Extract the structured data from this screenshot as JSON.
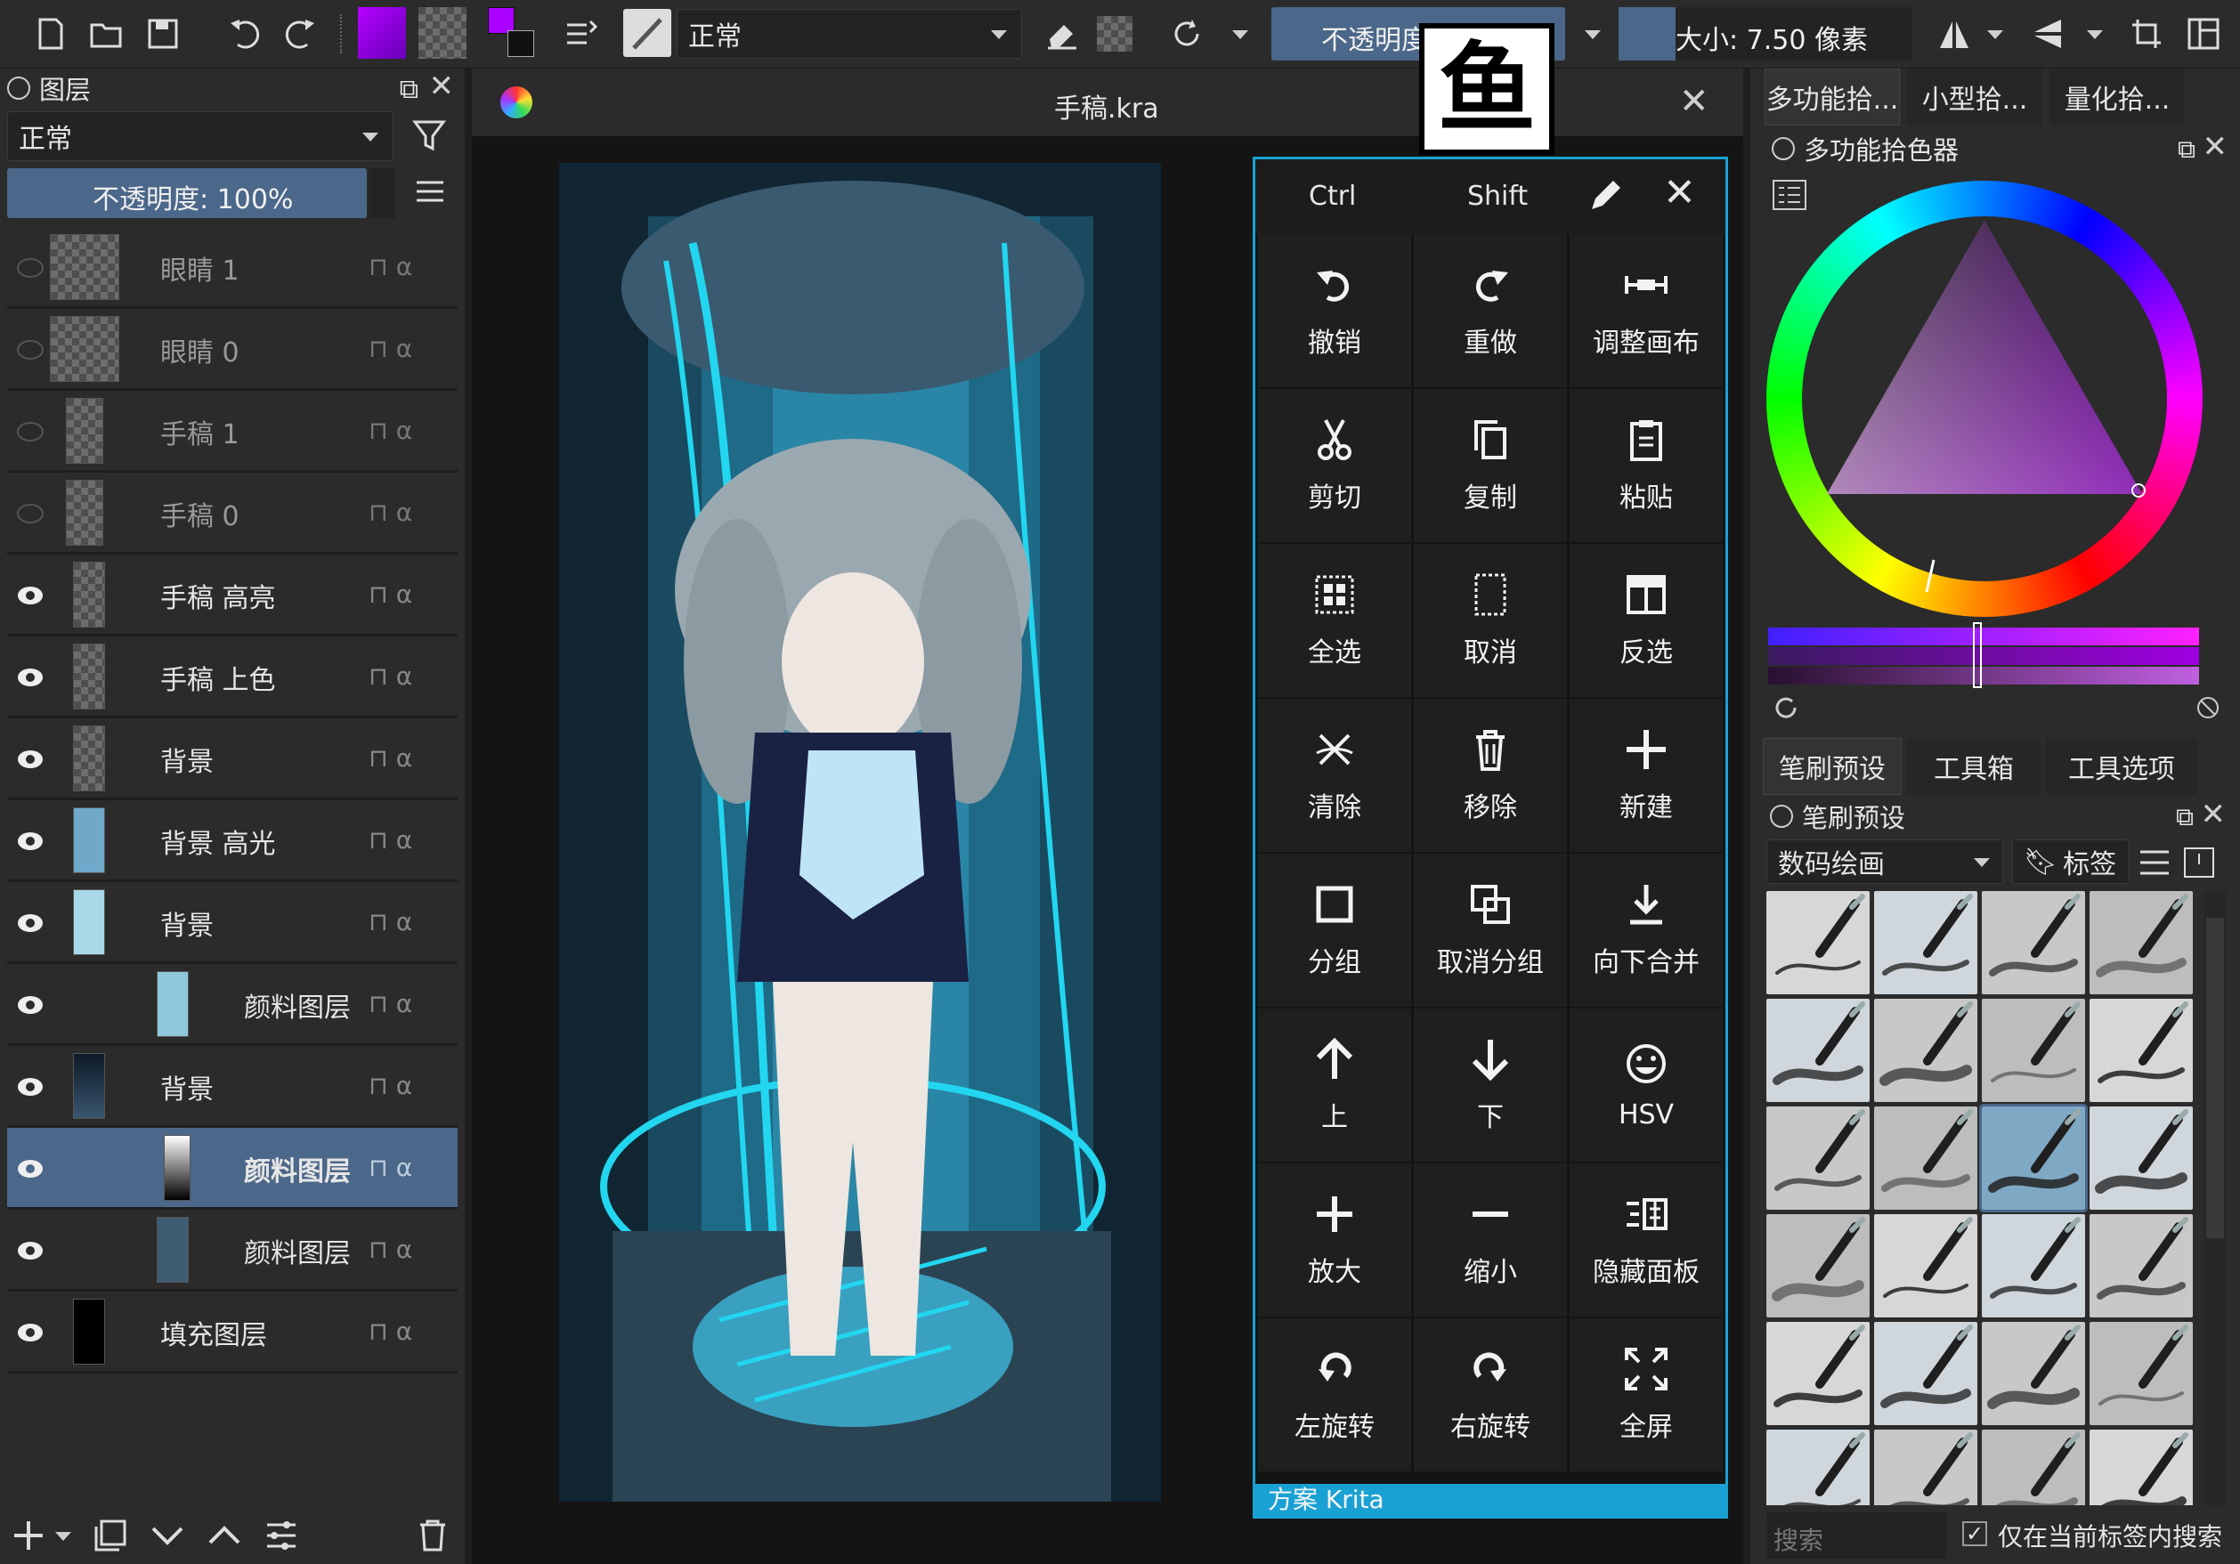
{
  "toolbar": {
    "blend_mode": "正常",
    "opacity_label": "不透明度",
    "size_label": "大小: 7.50 像素"
  },
  "watermark": "鱼",
  "layers_panel": {
    "title": "图层",
    "blend_mode": "正常",
    "opacity_label": "不透明度:  100%",
    "layers": [
      {
        "name": "眼睛 1",
        "visible": false,
        "selected": false
      },
      {
        "name": "眼睛 0",
        "visible": false,
        "selected": false
      },
      {
        "name": "手稿 1",
        "visible": false,
        "selected": false
      },
      {
        "name": "手稿 0",
        "visible": false,
        "selected": false
      },
      {
        "name": "手稿 高亮",
        "visible": true,
        "selected": false
      },
      {
        "name": "手稿 上色",
        "visible": true,
        "selected": false
      },
      {
        "name": "背景",
        "visible": true,
        "selected": false
      },
      {
        "name": "背景 高光",
        "visible": true,
        "selected": false
      },
      {
        "name": "背景",
        "visible": true,
        "selected": false
      },
      {
        "name": "颜料图层",
        "visible": true,
        "selected": false
      },
      {
        "name": "背景",
        "visible": true,
        "selected": false
      },
      {
        "name": "颜料图层",
        "visible": true,
        "selected": true
      },
      {
        "name": "颜料图层",
        "visible": true,
        "selected": false
      },
      {
        "name": "填充图层",
        "visible": true,
        "selected": false
      }
    ]
  },
  "document": {
    "title": "手稿.kra"
  },
  "touch_panel": {
    "modifier_ctrl": "Ctrl",
    "modifier_shift": "Shift",
    "buttons": [
      {
        "label": "撤销",
        "icon": "undo-icon"
      },
      {
        "label": "重做",
        "icon": "redo-icon"
      },
      {
        "label": "调整画布",
        "icon": "resize-canvas-icon"
      },
      {
        "label": "剪切",
        "icon": "cut-icon"
      },
      {
        "label": "复制",
        "icon": "copy-icon"
      },
      {
        "label": "粘贴",
        "icon": "paste-icon"
      },
      {
        "label": "全选",
        "icon": "select-all-icon"
      },
      {
        "label": "取消",
        "icon": "deselect-icon"
      },
      {
        "label": "反选",
        "icon": "invert-selection-icon"
      },
      {
        "label": "清除",
        "icon": "clear-icon"
      },
      {
        "label": "移除",
        "icon": "trash-icon"
      },
      {
        "label": "新建",
        "icon": "plus-icon"
      },
      {
        "label": "分组",
        "icon": "group-icon"
      },
      {
        "label": "取消分组",
        "icon": "ungroup-icon"
      },
      {
        "label": "向下合并",
        "icon": "merge-down-icon"
      },
      {
        "label": "上",
        "icon": "arrow-up-icon"
      },
      {
        "label": "下",
        "icon": "arrow-down-icon"
      },
      {
        "label": "HSV",
        "icon": "hsv-icon"
      },
      {
        "label": "放大",
        "icon": "zoom-in-icon"
      },
      {
        "label": "缩小",
        "icon": "zoom-out-icon"
      },
      {
        "label": "隐藏面板",
        "icon": "hide-panel-icon"
      },
      {
        "label": "左旋转",
        "icon": "rotate-left-icon"
      },
      {
        "label": "右旋转",
        "icon": "rotate-right-icon"
      },
      {
        "label": "全屏",
        "icon": "fullscreen-icon"
      }
    ],
    "footer": "方案 Krita"
  },
  "right_panel": {
    "top_tabs": [
      "多功能拾...",
      "小型拾...",
      "量化拾..."
    ],
    "color_picker_title": "多功能拾色器",
    "bottom_tabs": [
      "笔刷预设",
      "工具箱",
      "工具选项"
    ],
    "brush_title": "笔刷预设",
    "brush_category": "数码绘画",
    "tag_label": "标签",
    "search_placeholder": "搜索",
    "search_in_tag_label": "仅在当前标签内搜索"
  },
  "colors": {
    "foreground": "#aa00ff",
    "accent": "#1aa1d4",
    "selected_row": "#4b6789"
  }
}
